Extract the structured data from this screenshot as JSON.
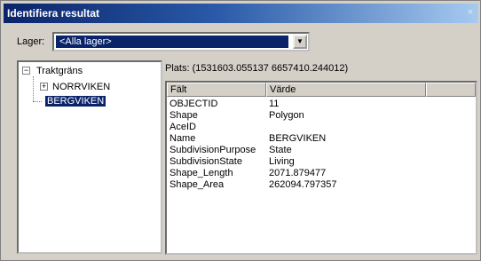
{
  "window": {
    "title": "Identifiera resultat",
    "close_glyph": "×"
  },
  "layers": {
    "label": "Lager:",
    "selected": "<Alla lager>",
    "arrow_glyph": "▼"
  },
  "tree": {
    "root": {
      "label": "Traktgräns",
      "expander": "−"
    },
    "children": [
      {
        "label": "NORRVIKEN",
        "expander": "+"
      },
      {
        "label": "BERGVIKEN",
        "selected": true
      }
    ]
  },
  "location": "Plats: (1531603.055137 6657410.244012)",
  "grid": {
    "columns": [
      "Fält",
      "Värde"
    ],
    "rows": [
      {
        "field": "OBJECTID",
        "value": "11"
      },
      {
        "field": "Shape",
        "value": "Polygon"
      },
      {
        "field": "AceID",
        "value": ""
      },
      {
        "field": "Name",
        "value": "BERGVIKEN"
      },
      {
        "field": "SubdivisionPurpose",
        "value": "State"
      },
      {
        "field": "SubdivisionState",
        "value": "Living"
      },
      {
        "field": "Shape_Length",
        "value": "2071.879477"
      },
      {
        "field": "Shape_Area",
        "value": "262094.797357"
      }
    ]
  },
  "colors": {
    "selection": "#0a246a",
    "face": "#d4d0c8"
  }
}
